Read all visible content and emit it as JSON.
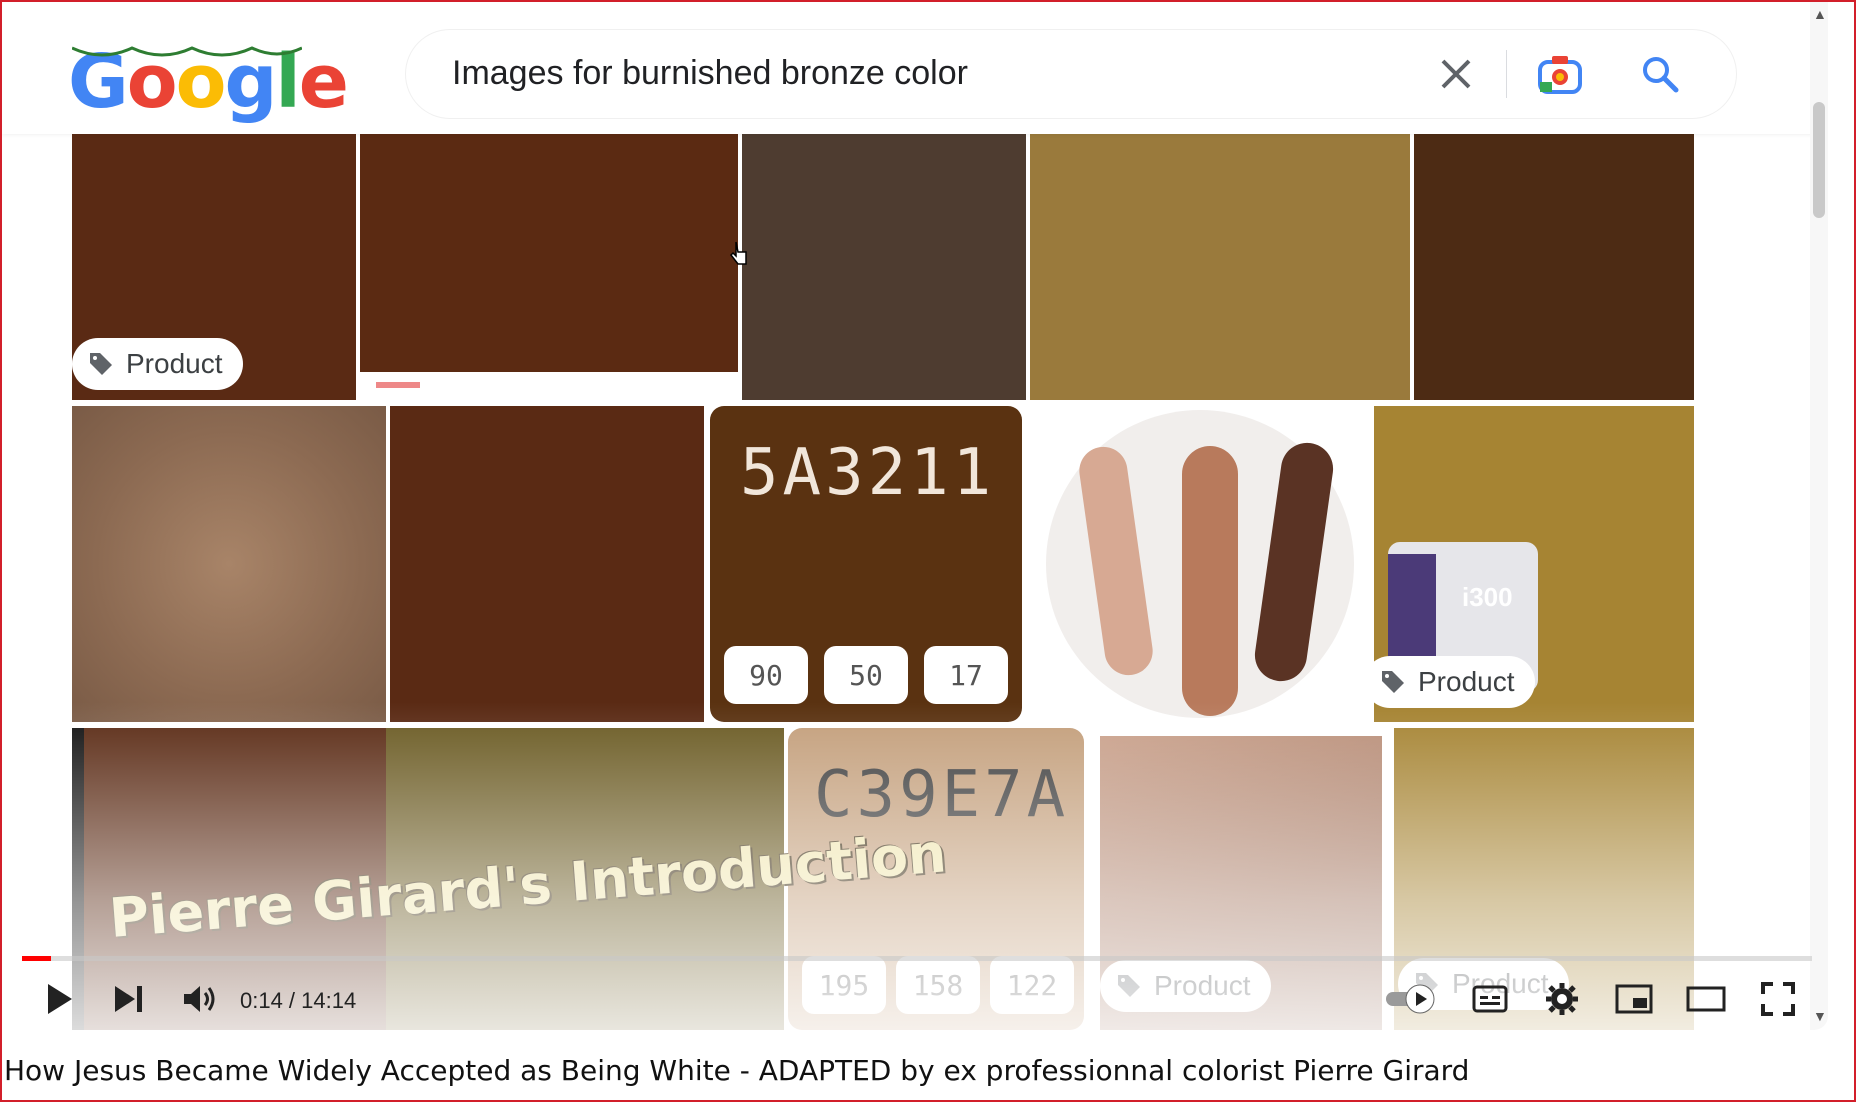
{
  "search": {
    "query": "Images for burnished bronze color"
  },
  "logo": {
    "letters": [
      "G",
      "o",
      "o",
      "g",
      "l",
      "e"
    ],
    "colors": [
      "#4285f4",
      "#ea4335",
      "#fbbc05",
      "#4285f4",
      "#34a853",
      "#ea4335"
    ]
  },
  "tiles": {
    "product_label": "Product",
    "hex_dark": "5A3211",
    "hex_dark_values": [
      "90",
      "50",
      "17"
    ],
    "hex_light": "C39E7A",
    "hex_light_values": [
      "195",
      "158",
      "122"
    ],
    "paint_brand": "i300",
    "overlay_caption": "Pierre Girard's Introduction"
  },
  "player": {
    "time": "0:14 / 14:14",
    "progress": 0.016,
    "accent_color": "#ff0000"
  },
  "video_title": "How Jesus Became Widely Accepted as Being White - ADAPTED by ex professionnal colorist Pierre Girard",
  "colors": {
    "frame_border": "#d21f2a",
    "bronze_dark": "#5a3211",
    "bronze_light": "#c39e7a"
  }
}
